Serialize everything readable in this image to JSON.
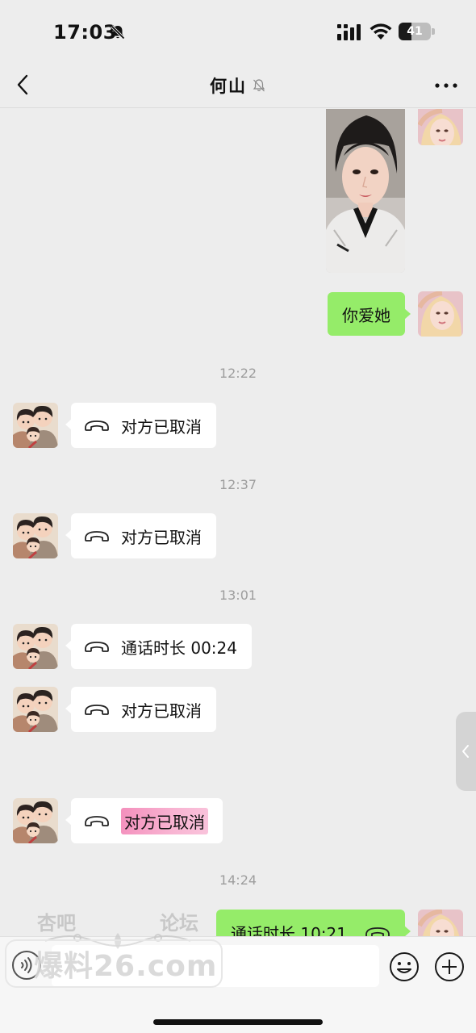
{
  "status_bar": {
    "time": "17:03",
    "battery_level": 41,
    "battery_label": "41",
    "icons": [
      "bell-slash-icon",
      "signal-icon",
      "wifi-icon",
      "battery-icon"
    ]
  },
  "header": {
    "title": "何山",
    "muted": true,
    "icons": [
      "back-chevron-icon",
      "bell-slash-icon",
      "more-dots-icon"
    ]
  },
  "messages": [
    {
      "type": "image",
      "from": "me",
      "content": "photo of a woman in a white jacket"
    },
    {
      "type": "text",
      "from": "me",
      "text": "你爱她"
    },
    {
      "type": "timestamp",
      "text": "12:22"
    },
    {
      "type": "call",
      "from": "contact",
      "text": "对方已取消"
    },
    {
      "type": "timestamp",
      "text": "12:37"
    },
    {
      "type": "call",
      "from": "contact",
      "text": "对方已取消"
    },
    {
      "type": "timestamp",
      "text": "13:01"
    },
    {
      "type": "call",
      "from": "contact",
      "text": "通话时长 00:24"
    },
    {
      "type": "call",
      "from": "contact",
      "text": "对方已取消"
    },
    {
      "type": "call",
      "from": "contact",
      "text": "对方已取消",
      "highlighted": true
    },
    {
      "type": "timestamp",
      "text": "14:24"
    },
    {
      "type": "call",
      "from": "me",
      "text": "通话时长 10:21"
    }
  ],
  "input_bar": {
    "value": "",
    "icons": [
      "voice-icon",
      "emoji-icon",
      "plus-icon"
    ]
  },
  "watermark": {
    "line1_left": "杏吧",
    "line1_right": "论坛",
    "main": "爆料26.com"
  },
  "colors": {
    "background": "#ededed",
    "my_bubble": "#95ec69",
    "their_bubble": "#ffffff",
    "timestamp": "#9d9d9d",
    "highlight": "#f06aa6"
  }
}
